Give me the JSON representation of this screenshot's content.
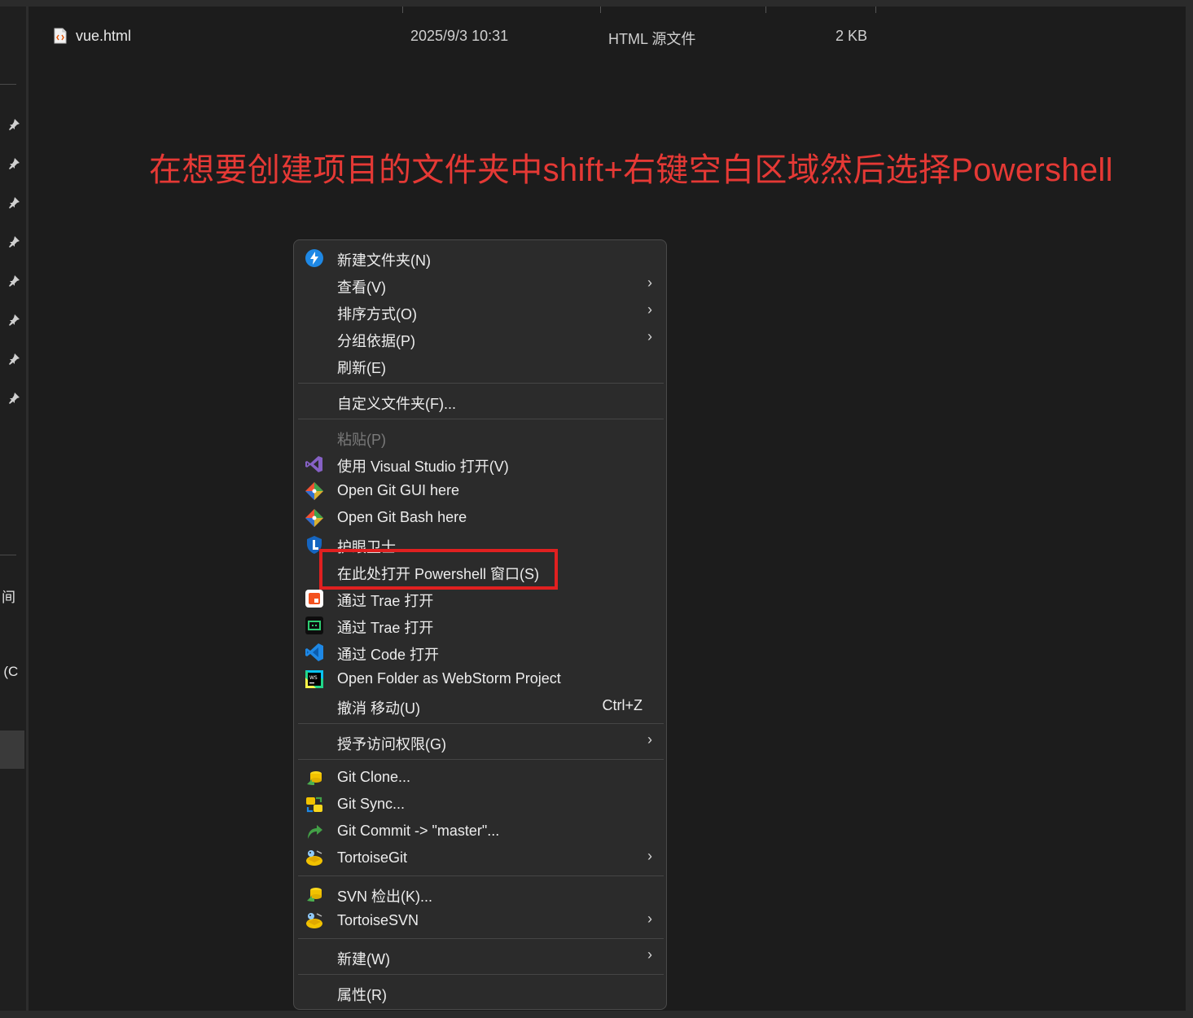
{
  "nav": {
    "fragment_1": "间",
    "fragment_2": ") (C"
  },
  "file": {
    "name": "vue.html",
    "date": "2025/9/3 10:31",
    "type": "HTML 源文件",
    "size": "2 KB"
  },
  "annotation": "在想要创建项目的文件夹中shift+右键空白区域然后选择Powershell",
  "menu": {
    "new_folder": "新建文件夹(N)",
    "view": "查看(V)",
    "sort_by": "排序方式(O)",
    "group_by": "分组依据(P)",
    "refresh": "刷新(E)",
    "customize": "自定义文件夹(F)...",
    "paste": "粘贴(P)",
    "open_vs": "使用 Visual Studio 打开(V)",
    "git_gui": "Open Git GUI here",
    "git_bash": "Open Git Bash here",
    "eye_guard": "护眼卫士",
    "powershell": "在此处打开 Powershell 窗口(S)",
    "trae_1": "通过 Trae 打开",
    "trae_2": "通过 Trae 打开",
    "code": "通过 Code 打开",
    "webstorm": "Open Folder as WebStorm Project",
    "undo_move": "撤消 移动(U)",
    "undo_shortcut": "Ctrl+Z",
    "grant_access": "授予访问权限(G)",
    "git_clone": "Git Clone...",
    "git_sync": "Git Sync...",
    "git_commit": "Git Commit -> \"master\"...",
    "tortoise_git": "TortoiseGit",
    "svn_checkout": "SVN 检出(K)...",
    "tortoise_svn": "TortoiseSVN",
    "new": "新建(W)",
    "properties": "属性(R)",
    "submenu_arrow": "›"
  },
  "colors": {
    "annotation": "#e53935",
    "highlight_border": "#e02020",
    "menu_bg": "#2b2b2b",
    "background": "#1c1c1c"
  },
  "icons": {
    "new_folder": "new-folder-bolt-icon",
    "visual_studio": "visual-studio-icon",
    "git": "git-diamond-icon",
    "eye_guard": "shield-icon",
    "trae": "trae-icon",
    "vscode": "vscode-icon",
    "webstorm": "webstorm-icon",
    "git_clone": "tortoise-clone-icon",
    "git_sync": "tortoise-sync-icon",
    "git_commit": "commit-arrow-icon",
    "tortoise": "tortoise-icon",
    "svn_checkout": "svn-checkout-icon",
    "pin": "pin-icon",
    "file": "html-file-icon"
  }
}
